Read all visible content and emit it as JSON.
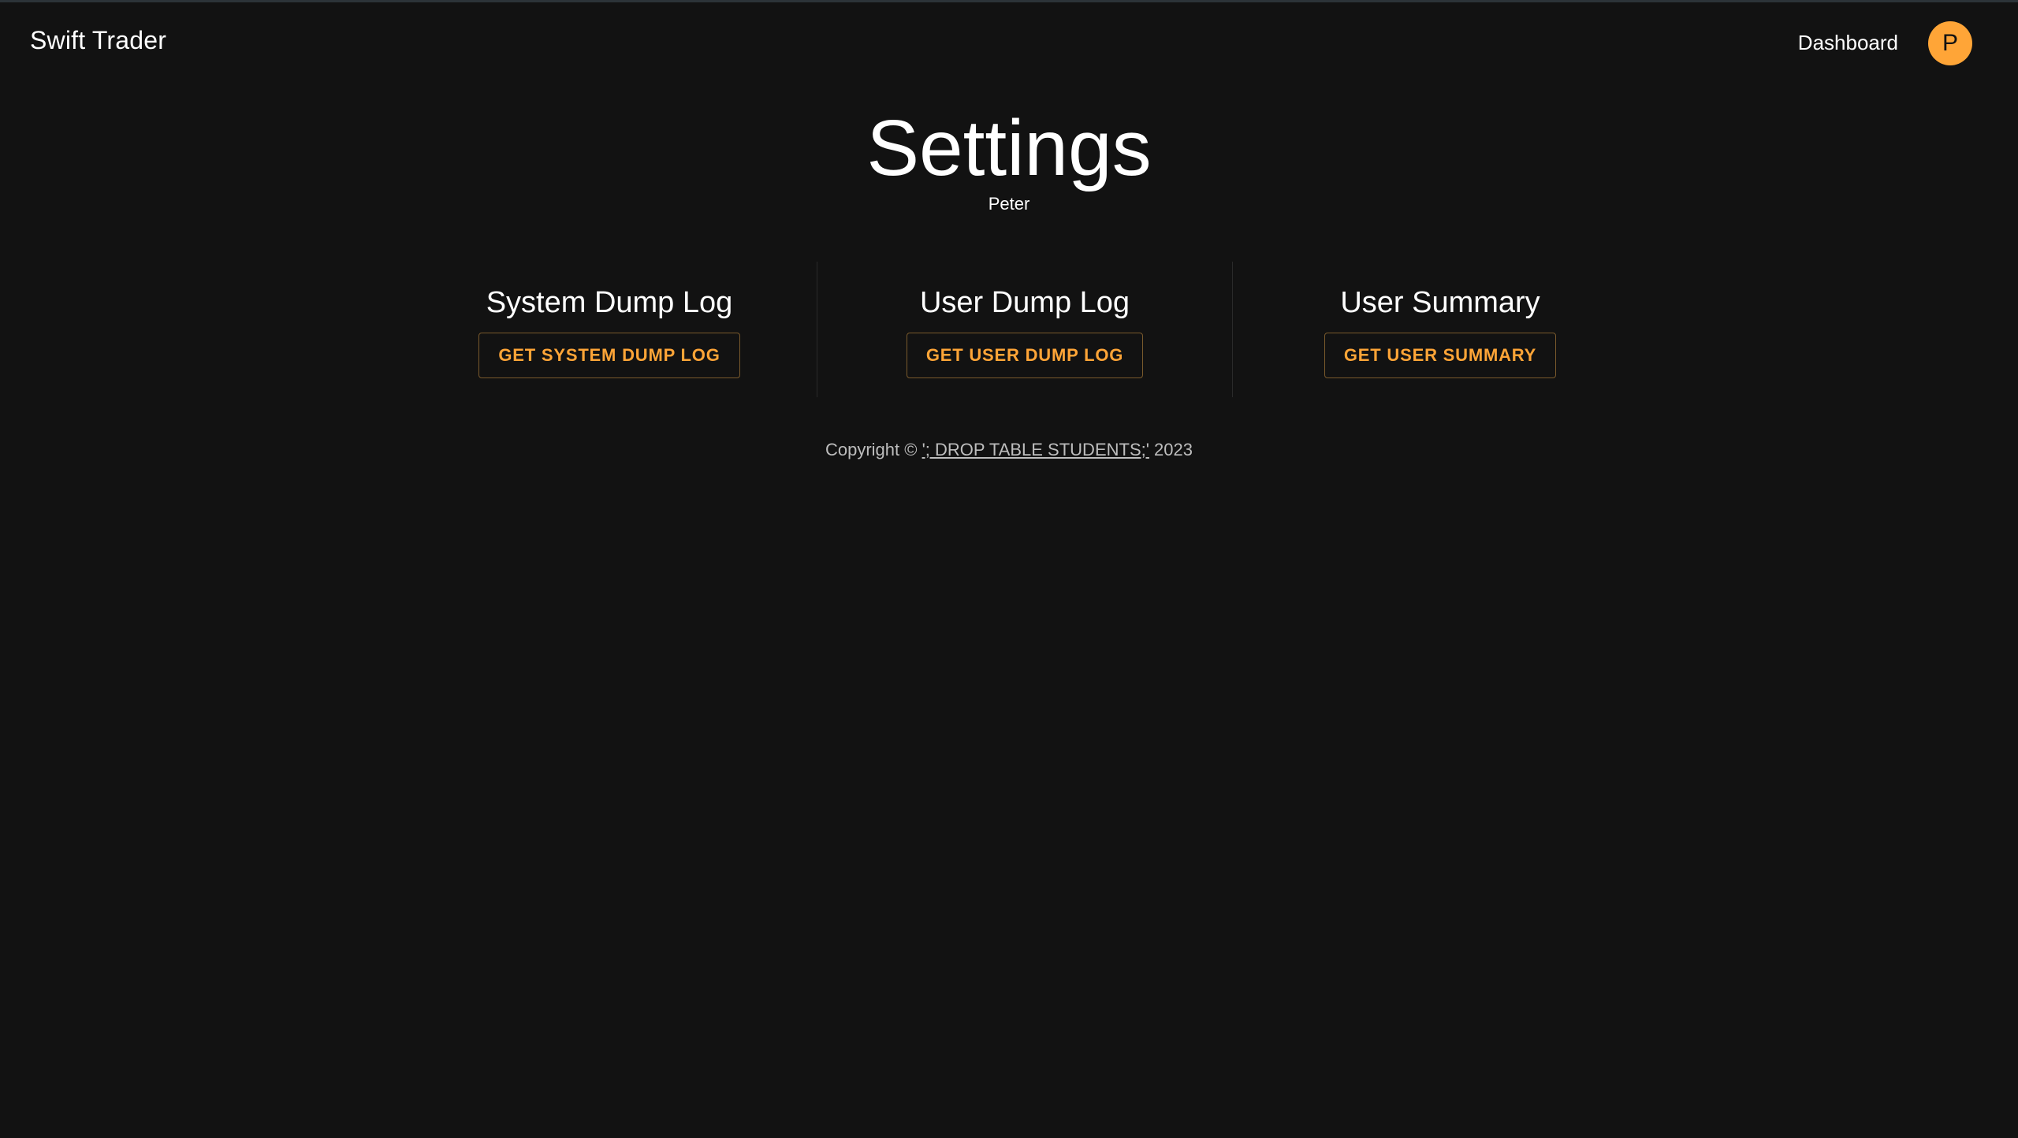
{
  "navbar": {
    "brand": "Swift Trader",
    "links": [
      {
        "label": "Dashboard"
      }
    ],
    "avatar_initial": "P"
  },
  "page": {
    "title": "Settings",
    "subtitle": "Peter"
  },
  "panels": [
    {
      "heading": "System Dump Log",
      "button_label": "GET SYSTEM DUMP LOG"
    },
    {
      "heading": "User Dump Log",
      "button_label": "GET USER DUMP LOG"
    },
    {
      "heading": "User Summary",
      "button_label": "GET USER SUMMARY"
    }
  ],
  "footer": {
    "prefix": "Copyright © ",
    "link_text": "'; DROP TABLE STUDENTS;'",
    "year": " 2023"
  },
  "colors": {
    "background": "#121212",
    "accent": "#ffa537",
    "text": "#ffffff",
    "muted_text": "#bdbdbd"
  }
}
